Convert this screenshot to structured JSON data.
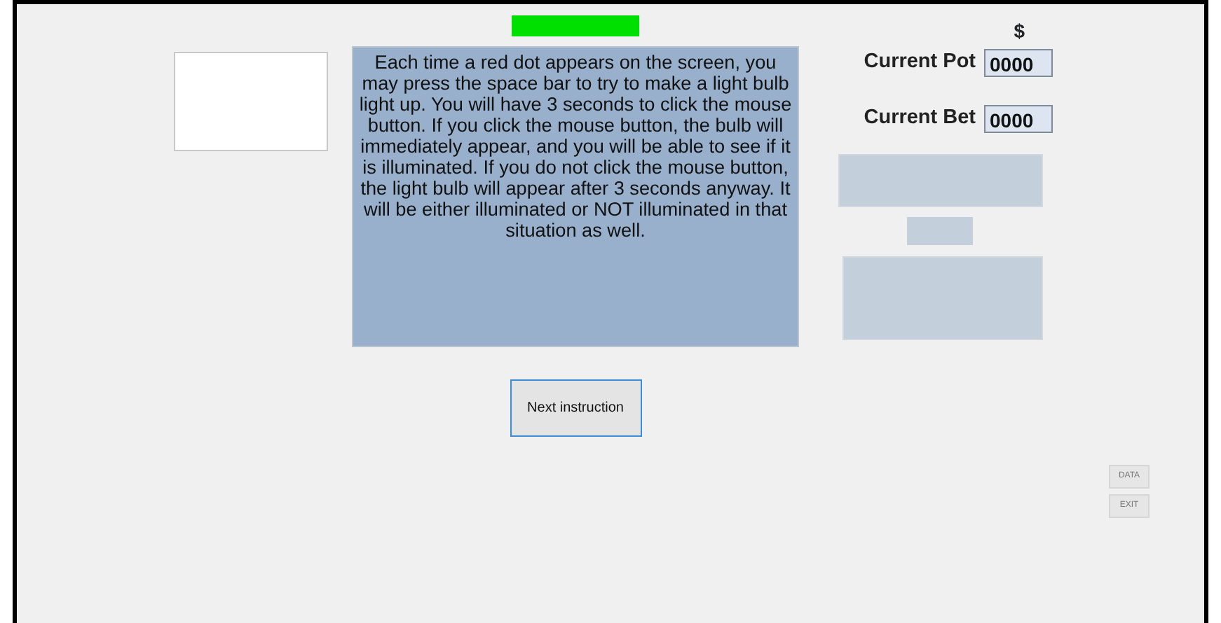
{
  "instructions": {
    "text": "Each time a red dot appears on the screen, you may press the space bar to try to make a light bulb light up. You will have 3 seconds to click the mouse button. If you click the mouse button, the bulb will immediately appear, and you will be able to see if it is illuminated. If you do not click the mouse button, the light bulb will appear after 3 seconds anyway. It will be either illuminated or NOT illuminated in that situation as well."
  },
  "next_button": "Next instruction",
  "currency": "$",
  "fields": [
    {
      "label": "Current Pot",
      "value": "0000"
    },
    {
      "label": "Current Bet",
      "value": "0000"
    }
  ],
  "side_buttons": [
    "DATA",
    "EXIT"
  ]
}
